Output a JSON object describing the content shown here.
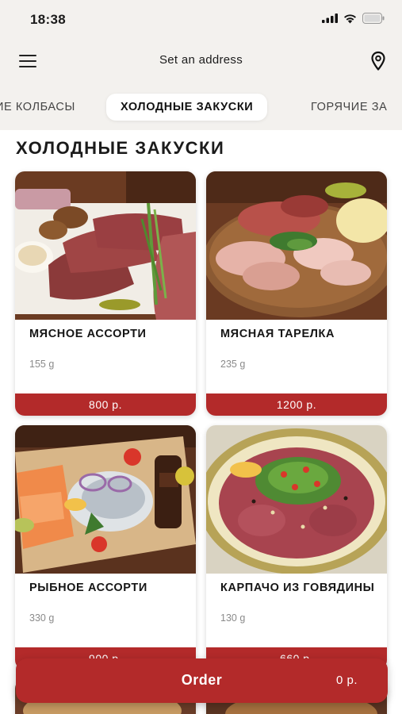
{
  "status_bar": {
    "time": "18:38"
  },
  "header": {
    "address_label": "Set an address"
  },
  "categories": [
    {
      "label": "ИЕ КОЛБАСЫ",
      "active": false
    },
    {
      "label": "ХОЛОДНЫЕ ЗАКУСКИ",
      "active": true
    },
    {
      "label": "ГОРЯЧИЕ ЗА",
      "active": false
    }
  ],
  "section": {
    "title": "ХОЛОДНЫЕ ЗАКУСКИ"
  },
  "products": [
    {
      "name": "МЯСНОЕ АССОРТИ",
      "weight": "155 g",
      "price": "800 р."
    },
    {
      "name": "МЯСНАЯ ТАРЕЛКА",
      "weight": "235 g",
      "price": "1200 р."
    },
    {
      "name": "РЫБНОЕ АССОРТИ",
      "weight": "330 g",
      "price": "900 р."
    },
    {
      "name": "КАРПАЧО ИЗ ГОВЯДИНЫ",
      "weight": "130 g",
      "price": "660 р."
    }
  ],
  "order": {
    "label": "Order",
    "total": "0 р."
  },
  "colors": {
    "accent": "#b32a2a",
    "background": "#f3f1ee",
    "card": "#ffffff"
  },
  "icons": [
    "signal-icon",
    "wifi-icon",
    "battery-icon",
    "menu-icon",
    "location-pin-icon"
  ]
}
